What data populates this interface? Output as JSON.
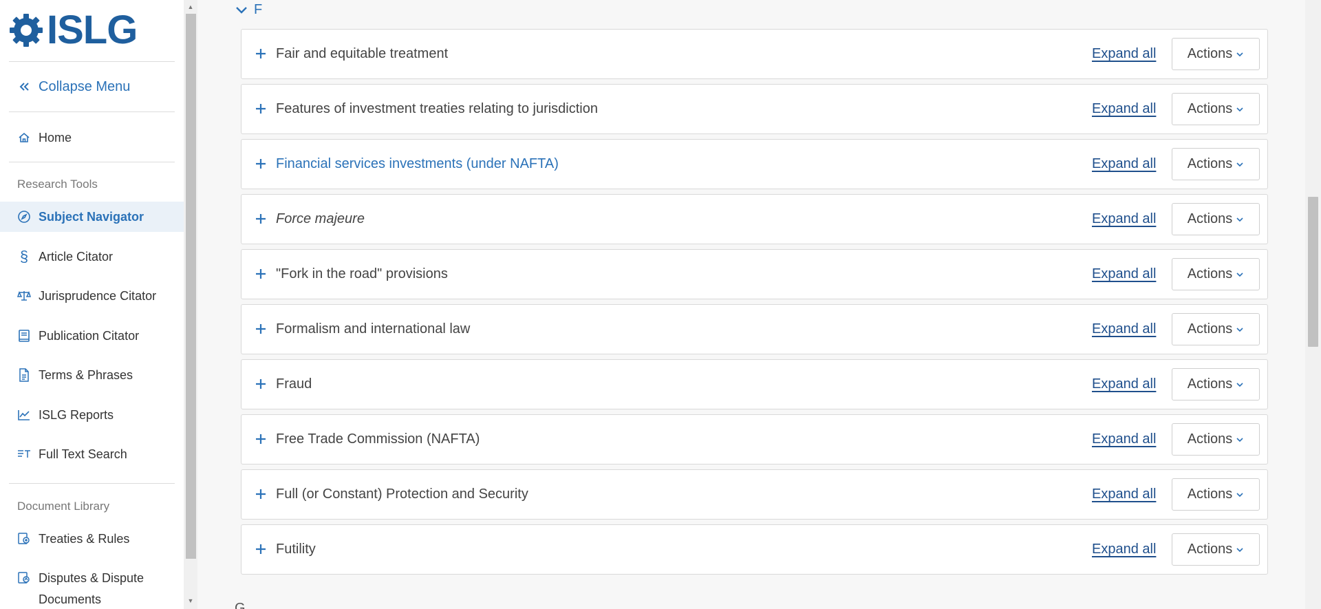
{
  "logo": {
    "text": "ISLG",
    "icon": "gear-icon"
  },
  "sidebar": {
    "collapse_label": "Collapse Menu",
    "home_label": "Home",
    "research_tools_title": "Research Tools",
    "research_items": [
      {
        "label": "Subject Navigator",
        "icon": "compass-icon",
        "active": true
      },
      {
        "label": "Article Citator",
        "icon": "section-icon"
      },
      {
        "label": "Jurisprudence Citator",
        "icon": "scales-icon"
      },
      {
        "label": "Publication Citator",
        "icon": "book-icon"
      },
      {
        "label": "Terms & Phrases",
        "icon": "document-icon"
      },
      {
        "label": "ISLG Reports",
        "icon": "chart-line-icon"
      },
      {
        "label": "Full Text Search",
        "icon": "text-search-icon"
      }
    ],
    "document_library_title": "Document Library",
    "library_items": [
      {
        "label": "Treaties & Rules",
        "icon": "treaties-icon"
      },
      {
        "label": "Disputes & Dispute Documents",
        "icon": "disputes-icon"
      }
    ]
  },
  "main": {
    "current_letter": "F",
    "next_letter": "G",
    "expand_label": "Expand all",
    "actions_label": "Actions",
    "topics": [
      {
        "label": "Fair and equitable treatment",
        "style": "normal"
      },
      {
        "label": "Features of investment treaties relating to jurisdiction",
        "style": "normal"
      },
      {
        "label": "Financial services investments (under NAFTA)",
        "style": "link"
      },
      {
        "label": "Force majeure",
        "style": "italic"
      },
      {
        "label": "\"Fork in the road\" provisions",
        "style": "normal"
      },
      {
        "label": "Formalism and international law",
        "style": "normal"
      },
      {
        "label": "Fraud",
        "style": "normal"
      },
      {
        "label": "Free Trade Commission (NAFTA)",
        "style": "normal"
      },
      {
        "label": "Full (or Constant) Protection and Security",
        "style": "normal"
      },
      {
        "label": "Futility",
        "style": "normal"
      }
    ]
  },
  "colors": {
    "accent": "#2b72b8",
    "brand": "#1f5f9e",
    "link_dark": "#1f4f8c"
  }
}
